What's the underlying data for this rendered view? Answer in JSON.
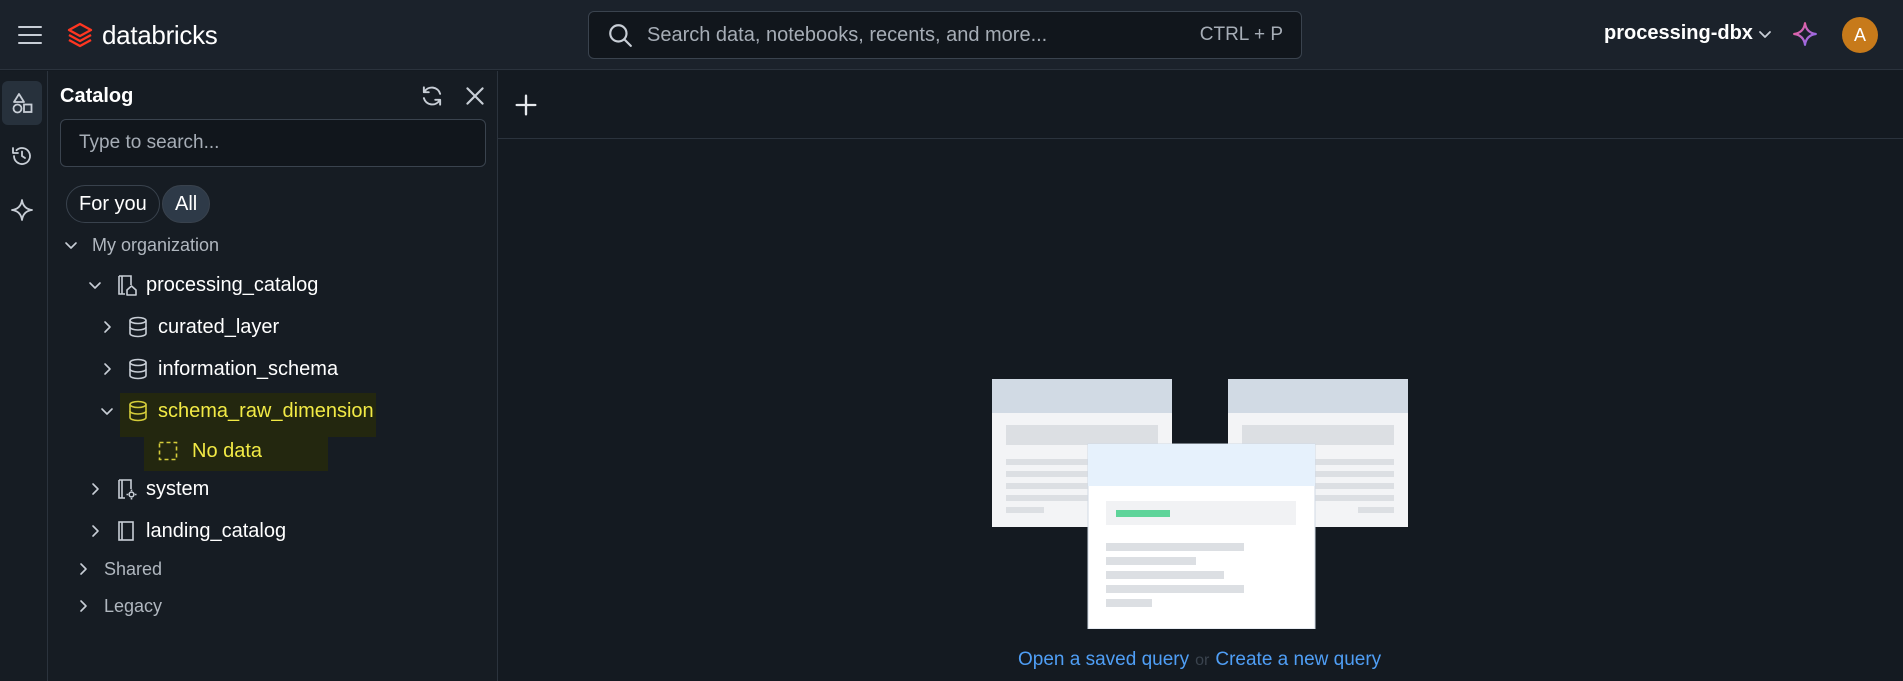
{
  "app": {
    "brand": "databricks",
    "search_placeholder": "Search data, notebooks, recents, and more...",
    "search_shortcut": "CTRL + P",
    "workspace": "processing-dbx",
    "avatar_initial": "A",
    "accent_color": "#4f9ef5",
    "highlight_color": "#f2ea45"
  },
  "rail": {
    "items": [
      {
        "icon": "catalog-shapes-icon"
      },
      {
        "icon": "history-icon"
      },
      {
        "icon": "assistant-sparkle-icon"
      }
    ]
  },
  "catalog": {
    "title": "Catalog",
    "search_placeholder": "Type to search...",
    "filters": [
      "For you",
      "All"
    ],
    "active_filter": "All",
    "tree": {
      "my_org": "My organization",
      "processing_catalog": "processing_catalog",
      "curated_layer": "curated_layer",
      "information_schema": "information_schema",
      "schema_raw_dimension": "schema_raw_dimension",
      "no_data": "No data",
      "system": "system",
      "landing_catalog": "landing_catalog",
      "shared": "Shared",
      "legacy": "Legacy"
    }
  },
  "main": {
    "open_saved": "Open a saved query",
    "or": "or",
    "create_new": "Create a new query"
  }
}
